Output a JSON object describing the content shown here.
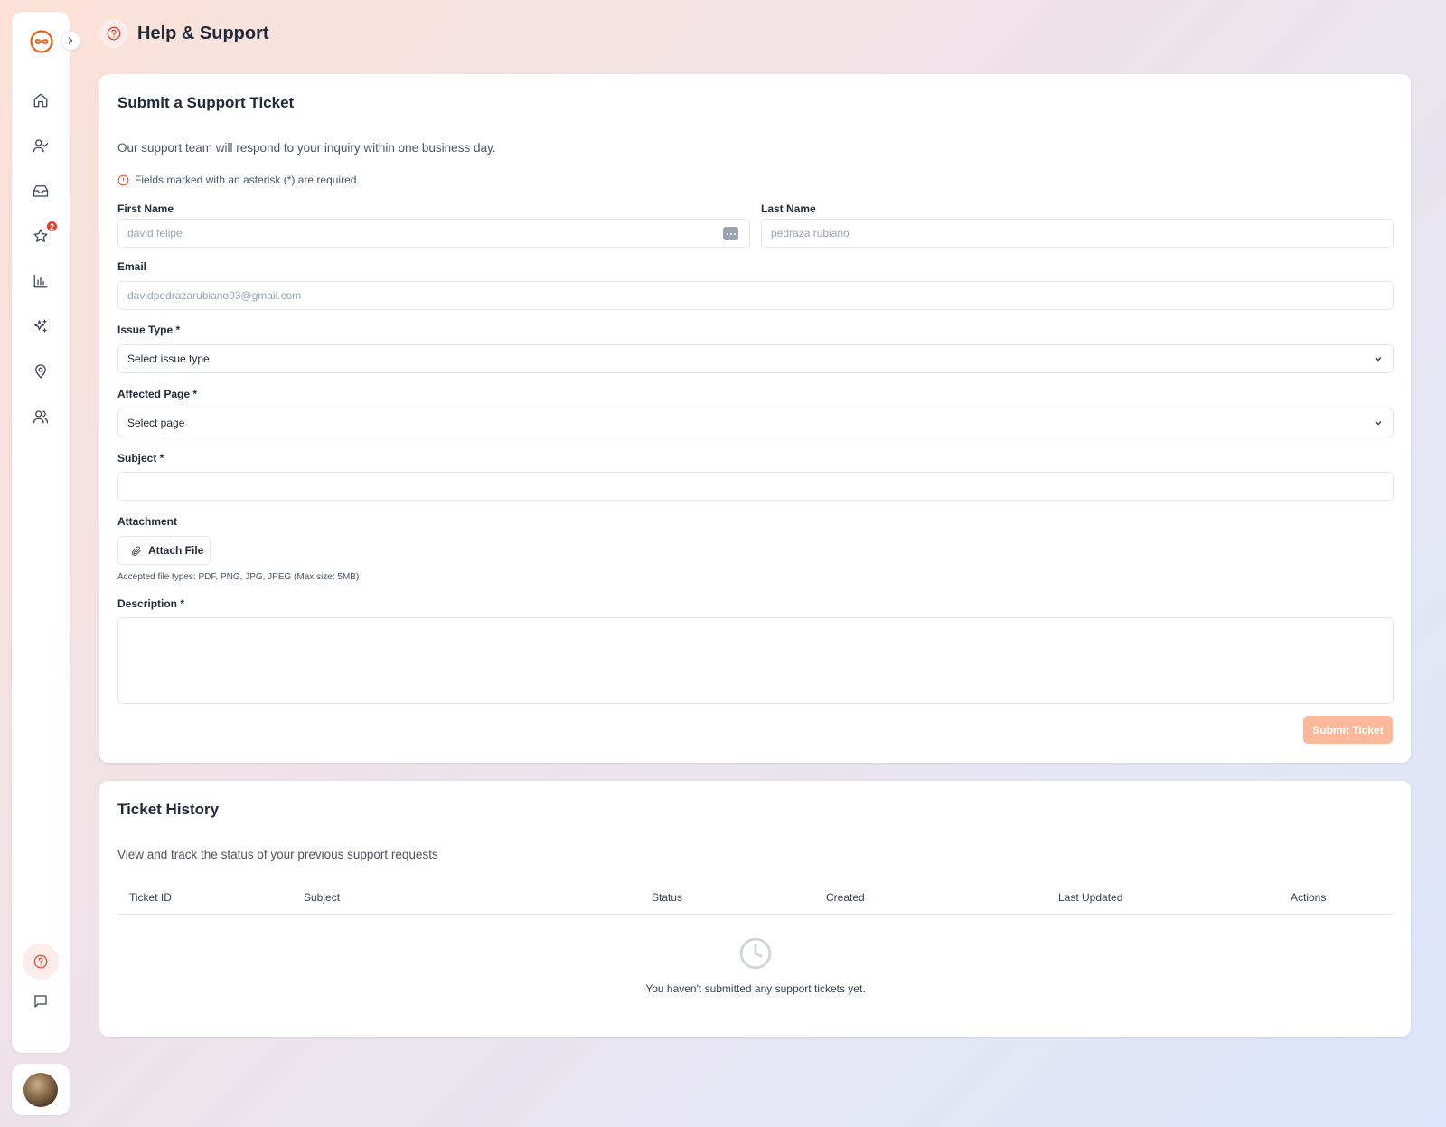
{
  "page": {
    "title": "Help & Support"
  },
  "sidebar": {
    "notification_badge": "2"
  },
  "ticket_form": {
    "title": "Submit a Support Ticket",
    "description": "Our support team will respond to your inquiry within one business day.",
    "required_note": "Fields marked with an asterisk (*) are required.",
    "first_name": {
      "label": "First Name",
      "value": "david felipe"
    },
    "last_name": {
      "label": "Last Name",
      "value": "pedraza rubiano"
    },
    "email": {
      "label": "Email",
      "value": "davidpedrazarubiano93@gmail.com"
    },
    "issue_type": {
      "label": "Issue Type *",
      "selected": "Select issue type"
    },
    "affected_page": {
      "label": "Affected Page *",
      "selected": "Select page"
    },
    "subject": {
      "label": "Subject *",
      "value": ""
    },
    "attachment": {
      "label": "Attachment",
      "button": "Attach File",
      "hint": "Accepted file types: PDF, PNG, JPG, JPEG (Max size: 5MB)"
    },
    "description_field": {
      "label": "Description *",
      "value": ""
    },
    "submit_label": "Submit Ticket"
  },
  "ticket_history": {
    "title": "Ticket History",
    "description": "View and track the status of your previous support requests",
    "columns": [
      "Ticket ID",
      "Subject",
      "Status",
      "Created",
      "Last Updated",
      "Actions"
    ],
    "empty_message": "You haven't submitted any support tickets yet."
  },
  "colors": {
    "accent": "#e5482f",
    "submit_disabled": "#fbb99a"
  }
}
